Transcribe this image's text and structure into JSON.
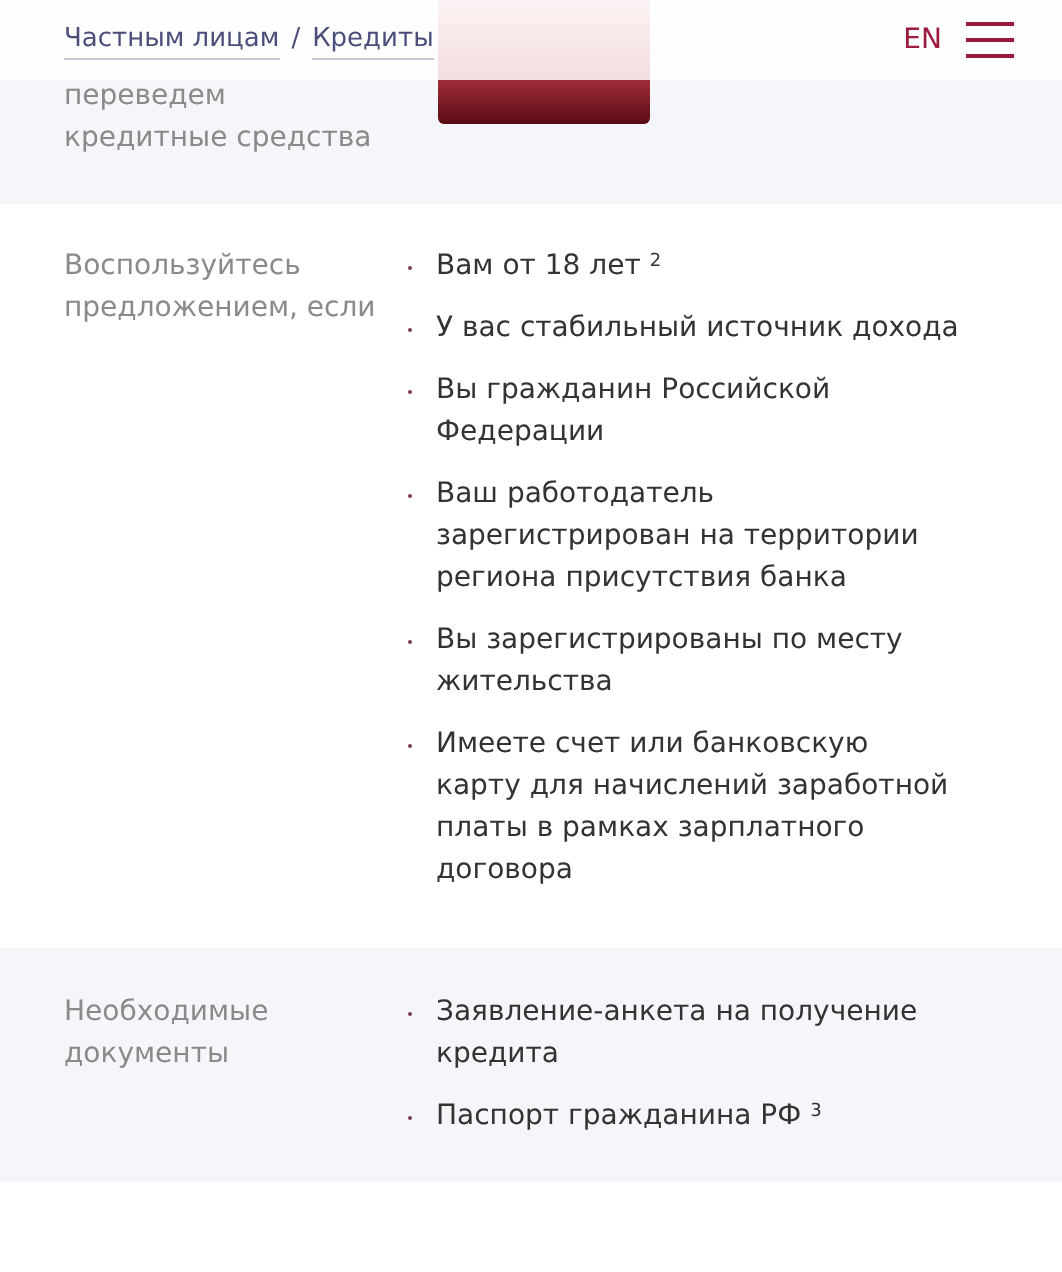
{
  "header": {
    "breadcrumbs": [
      {
        "label": "Частным лицам"
      },
      {
        "label": "Кредиты"
      }
    ],
    "separator": "/",
    "language": "EN"
  },
  "product": {
    "description": "переведем кредитные средства"
  },
  "sections": [
    {
      "label": "Воспользуйтесь предложением, если",
      "items": [
        "Вам от 18 лет $^{2}$",
        "У вас стабильный источник дохода",
        "Вы гражданин Российской Федерации",
        "Ваш работодатель зарегистрирован на территории региона присутствия банка",
        "Вы зарегистрированы по месту жительства",
        "Имеете счет или банковскую карту для начислений заработной платы в рамках зарплатного договора"
      ]
    },
    {
      "label": "Необходимые документы",
      "items": [
        "Заявление-анкета на получение кредита",
        "Паспорт гражданина РФ $^{3}$"
      ]
    }
  ]
}
